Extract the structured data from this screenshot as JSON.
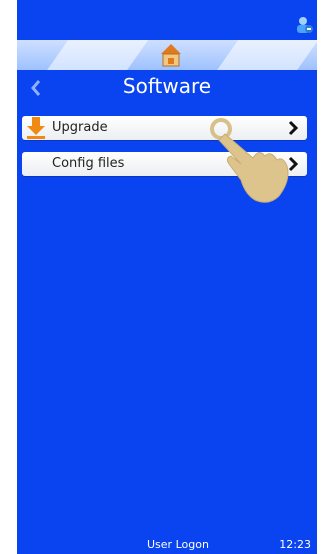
{
  "screen": {
    "title": "Software",
    "accent_color": "#0a44f0"
  },
  "menu": {
    "items": [
      {
        "label": "Upgrade",
        "icon": "download-arrow-icon"
      },
      {
        "label": "Config files",
        "icon": ""
      }
    ]
  },
  "footer": {
    "logon": "User Logon",
    "time": "12:23"
  },
  "icons": {
    "top_right": "user-icon",
    "home": "home-icon",
    "back": "back-arrow-icon",
    "overlay": "tap-hand-icon"
  }
}
